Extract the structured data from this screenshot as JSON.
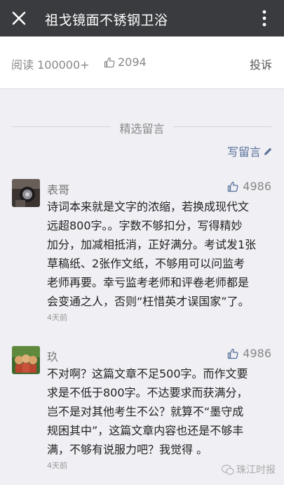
{
  "header": {
    "title": "祖戈镜面不锈钢卫浴",
    "close_icon": "close-icon",
    "more_icon": "more-vertical-icon"
  },
  "stats": {
    "reads": "阅读 100000+",
    "likes": "2094",
    "report": "投诉"
  },
  "comments_section": {
    "title": "精选留言",
    "write_label": "写留言"
  },
  "comments": [
    {
      "name": "表哥",
      "likes": "4986",
      "lines": [
        "诗词本来就是文字的浓缩，若换成现代文",
        "远超800字。。字数不够扣分，写得精妙",
        "加分，加减相抵消，正好满分。考试发1张",
        "草稿纸、2张作文纸，不够用可以问监考",
        "老师再要。幸亏监考老师和评卷老师都是",
        "会变通之人，否则“枉惜英才误国家”了。"
      ],
      "time": "4天前"
    },
    {
      "name": "玖",
      "likes": "4986",
      "lines": [
        "不对啊？这篇文章不足500字。而作文要",
        "求是不低于800字。不达要求而获满分，",
        "岂不是对其他考生不公？就算不“墨守成",
        "规困其中”，这篇文章内容也还是不够丰",
        "满，不够有说服力吧？我觉得 。"
      ],
      "time": "4天前"
    }
  ],
  "watermark": {
    "text": "珠江时报"
  },
  "colors": {
    "titlebar": "#3a3b3e",
    "link": "#58709a",
    "background": "#efeff4"
  }
}
